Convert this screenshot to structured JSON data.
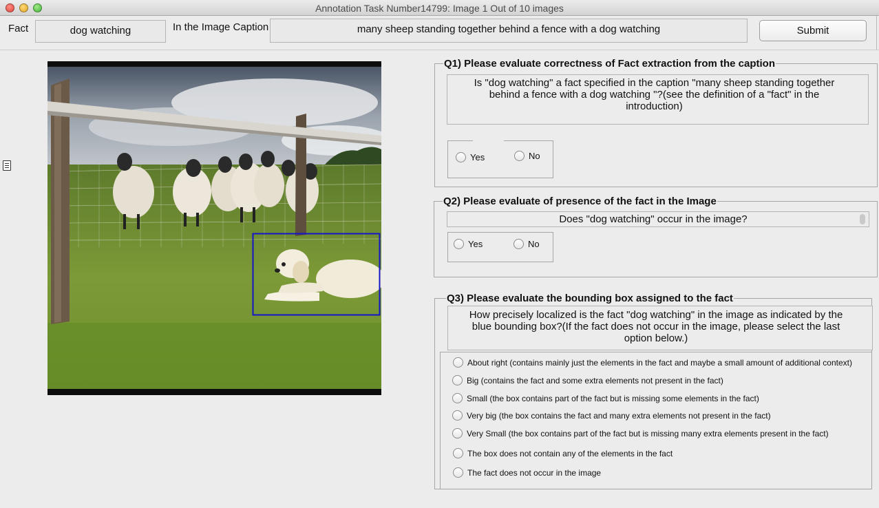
{
  "window": {
    "title": "Annotation Task Number14799: Image 1 Out of 10 images"
  },
  "toprow": {
    "fact_label": "Fact",
    "fact_value": "dog watching",
    "caption_label": "In the Image Caption",
    "caption_value": "many sheep standing together behind a fence with a dog watching",
    "submit_label": "Submit"
  },
  "q1": {
    "title": "Q1) Please evaluate correctness of Fact extraction from the caption",
    "question_lines": [
      "Is \"dog watching\" a fact specified in the caption \"many sheep standing together",
      "behind a fence with a dog watching \"?(see the definition of a \"fact\" in the",
      "introduction)"
    ],
    "options": [
      "Yes",
      "No"
    ]
  },
  "q2": {
    "title": "Q2) Please evaluate of presence of the fact in the Image",
    "question": "Does  \"dog watching\" occur in the image?",
    "options": [
      "Yes",
      "No"
    ]
  },
  "q3": {
    "title": "Q3) Please evaluate the bounding box assigned to the fact",
    "question_lines": [
      "How precisely localized is the fact \"dog watching\" in the image as indicated by the",
      "blue bounding box?(If the fact does not occur in the image, please select the last",
      "option below.)"
    ],
    "options": [
      "About right (contains mainly just the elements in the fact and maybe a small amount of additional context)",
      "Big (contains the fact and some extra elements not present in the fact)",
      "Small (the box contains part of the fact but is missing some elements in the fact)",
      "Very big (the box contains the fact and many extra elements not present in the fact)",
      "Very Small (the box contains part of the fact but is missing many extra elements present in the fact)",
      "The box does not contain any of the elements in the fact",
      "The fact does not occur in the image"
    ]
  },
  "colors": {
    "bounding_box": "#1414c8",
    "window_bg": "#ececec"
  }
}
